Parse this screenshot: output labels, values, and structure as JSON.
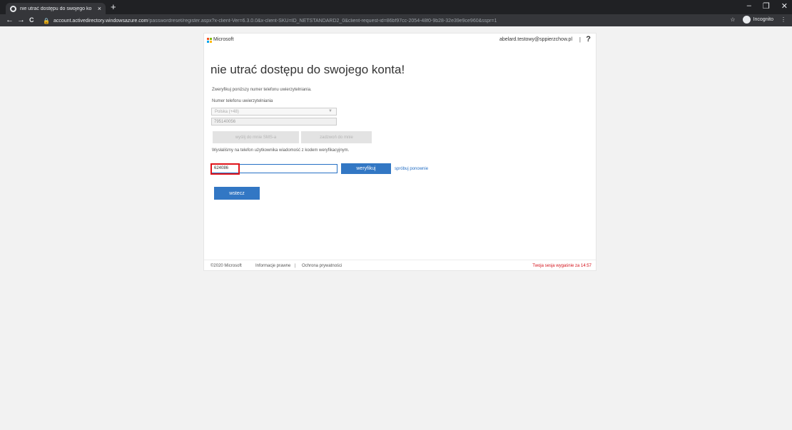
{
  "browser": {
    "tab_title": "nie utrać dostępu do swojego ko",
    "tab_close": "×",
    "new_tab": "+",
    "url_host": "account.activedirectory.windowsazure.com",
    "url_path": "/passwordreset/register.aspx?x-client-Ver=6.3.0.0&x-client-SKU=ID_NETSTANDARD2_0&client-request-id=86bf97cc-2054-48f0-9b28-32e39e9ce960&sspr=1",
    "incognito_label": "Incognito",
    "back": "←",
    "forward": "→",
    "reload": "C",
    "star": "☆",
    "menu": "⋮",
    "minimize": "–",
    "restore": "❐",
    "close": "✕",
    "lock": "🔒"
  },
  "header": {
    "brand": "Microsoft",
    "account": "abelard.testowy@sppierzchow.pl",
    "separator": "|",
    "help": "?",
    "logo_colors": [
      "#f25022",
      "#7fba00",
      "#00a4ef",
      "#ffb900"
    ]
  },
  "main": {
    "title": "nie utrać dostępu do swojego konta!",
    "instruction": "Zweryfikuj poniższy numer telefonu uwierzytelniania.",
    "phone_label": "Numer telefonu uwierzytelniania",
    "country_value": "Polska (+48)",
    "phone_value": "795140056",
    "sms_button": "wyślij do mnie SMS-a",
    "call_button": "zadzwoń do mnie",
    "sent_message": "Wysłaliśmy na telefon użytkownika wiadomość z kodem weryfikacyjnym.",
    "code_value": "624086",
    "verify_button": "weryfikuj",
    "retry_link": "spróbuj ponownie",
    "back_button": "wstecz"
  },
  "footer": {
    "copyright": "©2020 Microsoft",
    "legal": "Informacje prawne",
    "separator": "|",
    "privacy": "Ochrona prywatności",
    "session": "Twoja sesja wygaśnie za 14:57"
  },
  "colors": {
    "accent": "#3277c4",
    "highlight": "#e0151b",
    "session_warning": "#d4111a"
  }
}
